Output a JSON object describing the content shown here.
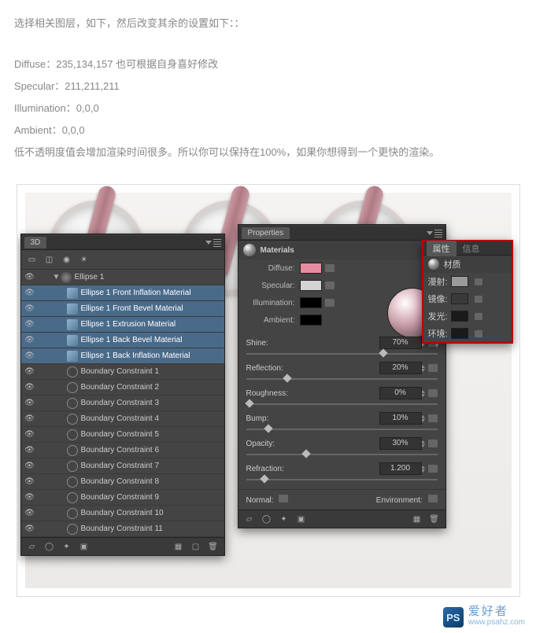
{
  "article": {
    "line1": "选择相关图层，如下，然后改变其余的设置如下：：",
    "diffuse": "Diffuse：235,134,157      也可根据自身喜好修改",
    "specular": "Specular：211,211,211",
    "illumination": "Illumination：0,0,0",
    "ambient": "Ambient：0,0,0",
    "note": "低不透明度值会增加渲染时间很多。所以你可以保持在100%，如果你想得到一个更快的渲染。"
  },
  "panel3d": {
    "title": "3D",
    "root": "Ellipse 1",
    "materials": [
      "Ellipse 1 Front Inflation Material",
      "Ellipse 1 Front Bevel Material",
      "Ellipse 1 Extrusion Material",
      "Ellipse 1 Back Bevel Material",
      "Ellipse 1 Back Inflation Material"
    ],
    "bounds": [
      "Boundary Constraint 1",
      "Boundary Constraint 2",
      "Boundary Constraint 3",
      "Boundary Constraint 4",
      "Boundary Constraint 5",
      "Boundary Constraint 6",
      "Boundary Constraint 7",
      "Boundary Constraint 8",
      "Boundary Constraint 9",
      "Boundary Constraint 10",
      "Boundary Constraint 11"
    ]
  },
  "props": {
    "title": "Properties",
    "section": "Materials",
    "labels": {
      "diffuse": "Diffuse:",
      "specular": "Specular:",
      "illumination": "Illumination:",
      "ambient": "Ambient:",
      "normal": "Normal:",
      "environment": "Environment:"
    },
    "colors": {
      "diffuse": "#e48da0",
      "specular": "#d3d3d3",
      "illumination": "#000000",
      "ambient": "#000000"
    },
    "sliders": [
      {
        "label": "Shine:",
        "value": "70%",
        "pos": 70
      },
      {
        "label": "Reflection:",
        "value": "20%",
        "pos": 20
      },
      {
        "label": "Roughness:",
        "value": "0%",
        "pos": 0
      },
      {
        "label": "Bump:",
        "value": "10%",
        "pos": 10
      },
      {
        "label": "Opacity:",
        "value": "30%",
        "pos": 30
      },
      {
        "label": "Refraction:",
        "value": "1.200",
        "pos": 8
      }
    ]
  },
  "propcn": {
    "tab1": "属性",
    "tab2": "信息",
    "section": "材质",
    "rows": [
      {
        "label": "漫射:",
        "color": "#9a9a9a"
      },
      {
        "label": "镜像:",
        "color": "#3a3a3a"
      },
      {
        "label": "发光:",
        "color": "#1a1a1a"
      },
      {
        "label": "环境:",
        "color": "#1a1a1a"
      }
    ]
  },
  "watermark": {
    "brand": "PS",
    "cn": "爱好者",
    "url": "www.psahz.com"
  }
}
